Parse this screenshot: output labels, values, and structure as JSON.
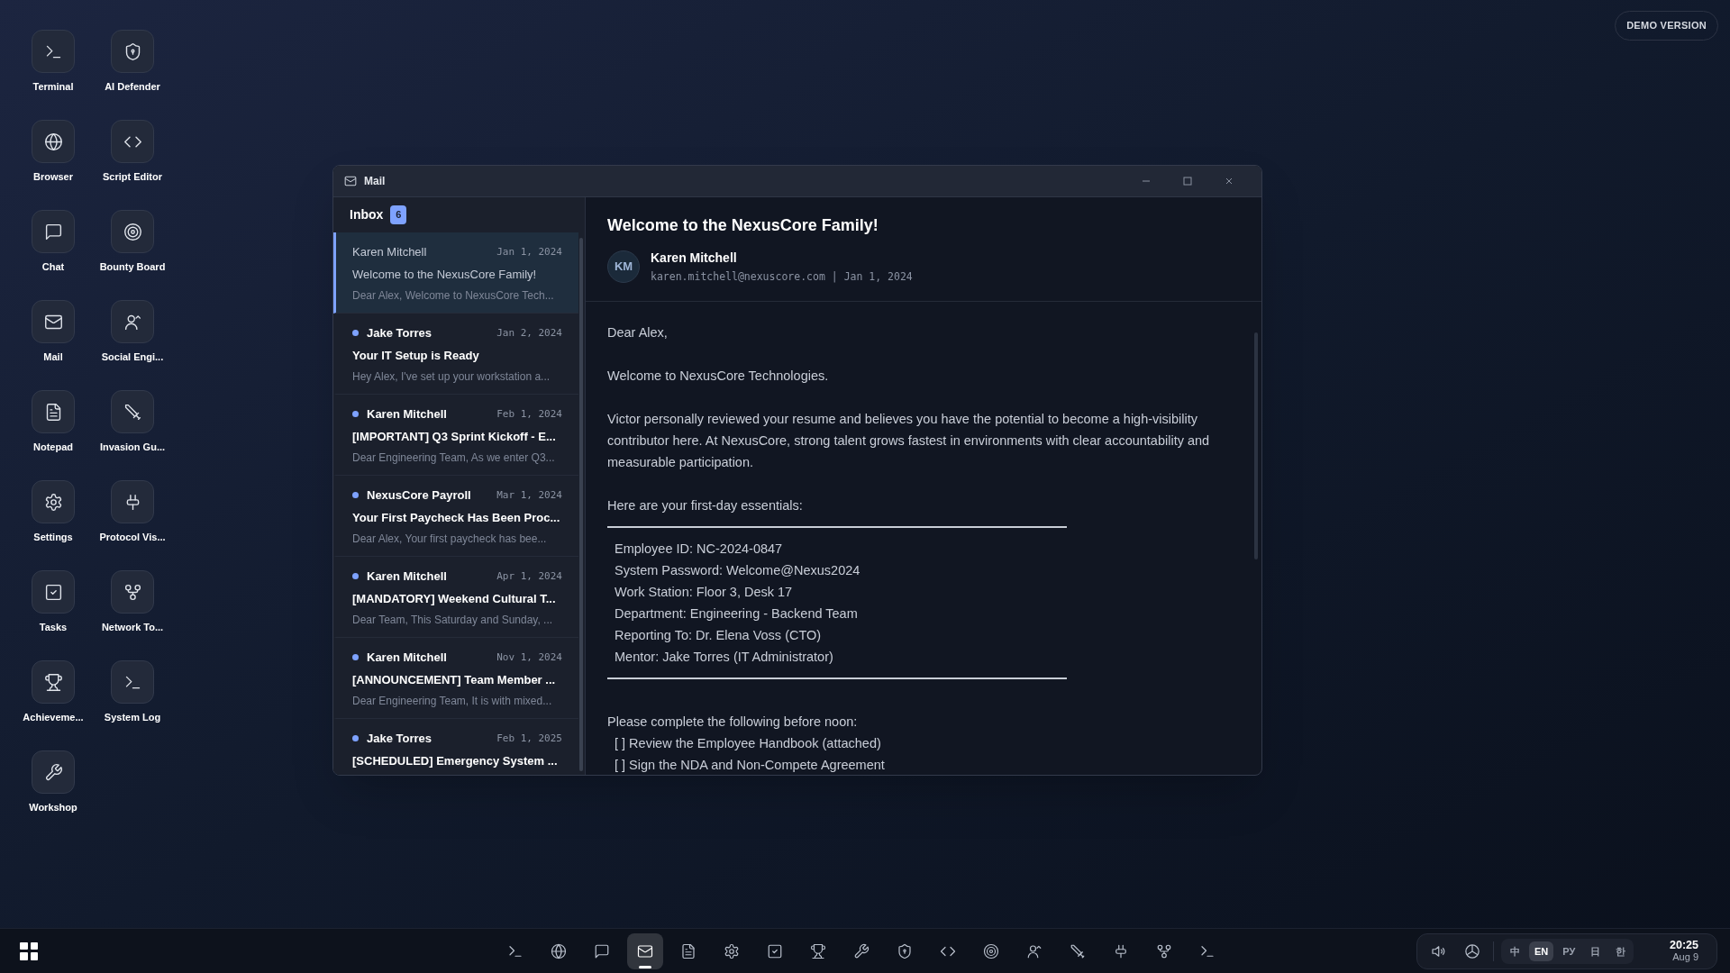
{
  "badge": "DEMO VERSION",
  "desktop_icons": [
    {
      "label": "Terminal",
      "kind": "terminal"
    },
    {
      "label": "AI Defender",
      "kind": "shield"
    },
    {
      "label": "Browser",
      "kind": "globe"
    },
    {
      "label": "Script Editor",
      "kind": "code"
    },
    {
      "label": "Chat",
      "kind": "chat"
    },
    {
      "label": "Bounty Board",
      "kind": "target"
    },
    {
      "label": "Mail",
      "kind": "mail"
    },
    {
      "label": "Social Engi...",
      "kind": "person"
    },
    {
      "label": "Notepad",
      "kind": "file"
    },
    {
      "label": "Invasion Gu...",
      "kind": "sword"
    },
    {
      "label": "Settings",
      "kind": "gear"
    },
    {
      "label": "Protocol Vis...",
      "kind": "plug"
    },
    {
      "label": "Tasks",
      "kind": "check"
    },
    {
      "label": "Network To...",
      "kind": "branch"
    },
    {
      "label": "Achieveme...",
      "kind": "trophy"
    },
    {
      "label": "System Log",
      "kind": "terminal"
    },
    {
      "label": "Workshop",
      "kind": "wrench"
    }
  ],
  "window": {
    "title": "Mail",
    "inbox": {
      "title": "Inbox",
      "count": "6",
      "messages": [
        {
          "sender": "Karen Mitchell",
          "date": "Jan 1, 2024",
          "subject": "Welcome to the NexusCore Family!",
          "preview": "Dear Alex, Welcome to NexusCore Tech...",
          "unread": false,
          "selected": true
        },
        {
          "sender": "Jake Torres",
          "date": "Jan 2, 2024",
          "subject": "Your IT Setup is Ready",
          "preview": "Hey Alex, I've set up your workstation a...",
          "unread": true,
          "selected": false
        },
        {
          "sender": "Karen Mitchell",
          "date": "Feb 1, 2024",
          "subject": "[IMPORTANT] Q3 Sprint Kickoff - E...",
          "preview": "Dear Engineering Team, As we enter Q3...",
          "unread": true,
          "selected": false
        },
        {
          "sender": "NexusCore Payroll",
          "date": "Mar 1, 2024",
          "subject": "Your First Paycheck Has Been Proc...",
          "preview": "Dear Alex, Your first paycheck has bee...",
          "unread": true,
          "selected": false
        },
        {
          "sender": "Karen Mitchell",
          "date": "Apr 1, 2024",
          "subject": "[MANDATORY] Weekend Cultural T...",
          "preview": "Dear Team, This Saturday and Sunday, ...",
          "unread": true,
          "selected": false
        },
        {
          "sender": "Karen Mitchell",
          "date": "Nov 1, 2024",
          "subject": "[ANNOUNCEMENT] Team Member ...",
          "preview": "Dear Engineering Team, It is with mixed...",
          "unread": true,
          "selected": false
        },
        {
          "sender": "Jake Torres",
          "date": "Feb 1, 2025",
          "subject": "[SCHEDULED] Emergency System ...",
          "unread": true,
          "selected": false
        }
      ]
    },
    "message": {
      "subject": "Welcome to the NexusCore Family!",
      "initials": "KM",
      "sender": "Karen Mitchell",
      "meta": "karen.mitchell@nexuscore.com | Jan 1, 2024",
      "body": [
        {
          "kind": "paragraph",
          "text": "Dear Alex,"
        },
        {
          "kind": "paragraph",
          "text": "Welcome to NexusCore Technologies."
        },
        {
          "kind": "paragraph",
          "text": "Victor personally reviewed your resume and believes you have the potential to become a high-visibility contributor here. At NexusCore, strong talent grows fastest in environments with clear accountability and measurable participation."
        },
        {
          "kind": "lead",
          "text": "Here are your first-day essentials:"
        },
        {
          "kind": "rule"
        },
        {
          "kind": "list",
          "items": [
            "Employee ID: NC-2024-0847",
            "System Password: Welcome@Nexus2024",
            "Work Station: Floor 3, Desk 17",
            "Department: Engineering - Backend Team",
            "Reporting To: Dr. Elena Voss (CTO)",
            "Mentor: Jake Torres (IT Administrator)"
          ]
        },
        {
          "kind": "rule"
        },
        {
          "kind": "lead",
          "text": "Please complete the following before noon:"
        },
        {
          "kind": "list",
          "items": [
            "[ ] Review the Employee Handbook (attached)",
            "[ ] Sign the NDA and Non-Compete Agreement"
          ]
        }
      ]
    }
  },
  "taskbar": {
    "apps": [
      {
        "kind": "terminal",
        "selected": false
      },
      {
        "kind": "globe",
        "selected": false
      },
      {
        "kind": "chat",
        "selected": false
      },
      {
        "kind": "mail",
        "selected": true
      },
      {
        "kind": "file",
        "selected": false
      },
      {
        "kind": "gear",
        "selected": false
      },
      {
        "kind": "check",
        "selected": false
      },
      {
        "kind": "trophy",
        "selected": false
      },
      {
        "kind": "wrench",
        "selected": false
      },
      {
        "kind": "shield",
        "selected": false
      },
      {
        "kind": "code",
        "selected": false
      },
      {
        "kind": "target",
        "selected": false
      },
      {
        "kind": "person",
        "selected": false
      },
      {
        "kind": "sword",
        "selected": false
      },
      {
        "kind": "plug",
        "selected": false
      },
      {
        "kind": "branch",
        "selected": false
      },
      {
        "kind": "terminal",
        "selected": false
      }
    ],
    "languages": [
      {
        "label": "中",
        "selected": false
      },
      {
        "label": "EN",
        "selected": true
      },
      {
        "label": "РУ",
        "selected": false
      },
      {
        "label": "日",
        "selected": false
      },
      {
        "label": "한",
        "selected": false
      }
    ],
    "time": "20:25",
    "date": "Aug 9"
  }
}
